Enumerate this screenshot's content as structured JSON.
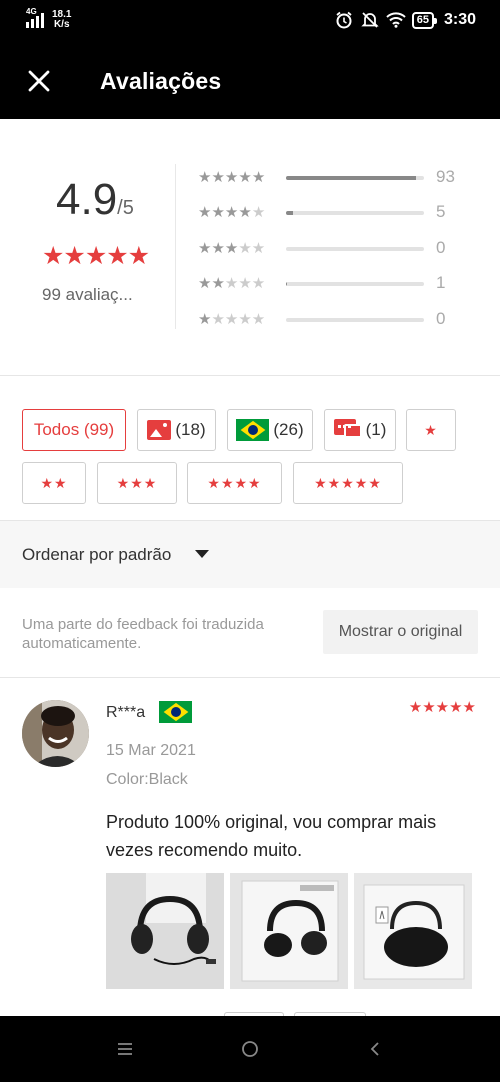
{
  "status_bar": {
    "network": "4G",
    "speed_value": "18.1",
    "speed_unit": "K/s",
    "battery": "65",
    "time": "3:30"
  },
  "header": {
    "title": "Avaliações",
    "close_icon": "close-icon"
  },
  "summary": {
    "score": "4.9",
    "score_of": "/5",
    "average_stars": 5,
    "count_label": "99 avaliaç...",
    "distribution": [
      {
        "stars": 5,
        "count": "93",
        "fraction": 0.94
      },
      {
        "stars": 4,
        "count": "5",
        "fraction": 0.05
      },
      {
        "stars": 3,
        "count": "0",
        "fraction": 0
      },
      {
        "stars": 2,
        "count": "1",
        "fraction": 0.01
      },
      {
        "stars": 1,
        "count": "0",
        "fraction": 0
      }
    ]
  },
  "filters": {
    "all_label": "Todos (99)",
    "photos_count": "(18)",
    "country_count": "(26)",
    "comments_count": "(1)",
    "star_chips": [
      "★",
      "★★",
      "★★★",
      "★★★★",
      "★★★★★"
    ],
    "colors": {
      "accent": "#e53e3e",
      "border": "#cfcfcf"
    }
  },
  "sort": {
    "label": "Ordenar por padrão"
  },
  "translation": {
    "note": "Uma parte do feedback foi traduzida automaticamente.",
    "button": "Mostrar o original"
  },
  "review": {
    "reviewer": "R***a",
    "country_flag": "brazil-flag",
    "rating": 5,
    "stars": "★★★★★",
    "date": "15 Mar 2021",
    "color": "Color:Black",
    "text": "Produto 100% original, vou comprar mais vezes recomendo muito.",
    "photos": [
      "headphones-photo-1",
      "headphones-photo-2",
      "headphones-photo-3"
    ]
  },
  "nav": {
    "buttons": [
      "menu-icon",
      "home-icon",
      "back-icon"
    ]
  }
}
